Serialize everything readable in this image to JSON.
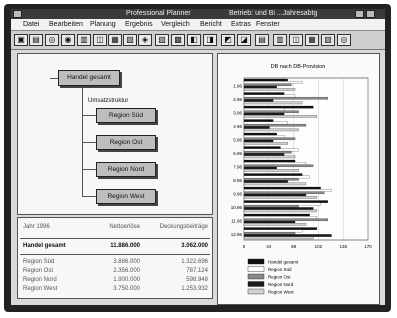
{
  "window": {
    "title": "Professional Planner",
    "subtitle": "Betrieb: und Bi ...Jahresabtg"
  },
  "menu": [
    "Datei",
    "Bearbeiten",
    "Planung",
    "Ergebnis",
    "Vergleich",
    "Bericht",
    "Extras",
    "Fenster"
  ],
  "tree": {
    "root": "Handel gesamt",
    "group_label": "Umsatzstruktur",
    "children": [
      "Region Süd",
      "Region Ost",
      "Region Nord",
      "Region West"
    ]
  },
  "table": {
    "headers": [
      "Jahr 1996",
      "Nettoerlöse",
      "Deckungsbeiträge"
    ],
    "total": {
      "name": "Handel gesamt",
      "net": "11.886.000",
      "db": "3.062.000"
    },
    "rows": [
      {
        "name": "Region Süd",
        "net": "3.886.000",
        "db": "1.322.696"
      },
      {
        "name": "Region Ost",
        "net": "2.356.000",
        "db": "787.124"
      },
      {
        "name": "Region Nord",
        "net": "1.900.000",
        "db": "598.948"
      },
      {
        "name": "Region West",
        "net": "3.750.000",
        "db": "1.253.932"
      }
    ]
  },
  "chart_data": {
    "type": "bar",
    "title": "DB nach DB-Provision",
    "categories": [
      "1.96",
      "2.96",
      "3.96",
      "4.96",
      "5.96",
      "6.96",
      "7.96",
      "8.96",
      "9.96",
      "10.96",
      "11.96",
      "12.96"
    ],
    "xlim": [
      0,
      170
    ],
    "xticks": [
      "0",
      "34",
      "68",
      "102",
      "136",
      "170"
    ],
    "series": [
      {
        "name": "Handel gesamt",
        "color": "#111111",
        "values": [
          60,
          55,
          95,
          40,
          45,
          50,
          70,
          80,
          105,
          115,
          90,
          100
        ]
      },
      {
        "name": "Region Süd",
        "color": "#ffffff",
        "values": [
          80,
          70,
          55,
          60,
          55,
          75,
          85,
          90,
          120,
          105,
          100,
          80
        ]
      },
      {
        "name": "Region Ost",
        "color": "#8a8a8a",
        "values": [
          65,
          115,
          75,
          85,
          70,
          65,
          95,
          75,
          110,
          75,
          115,
          70
        ]
      },
      {
        "name": "Region Nord",
        "color": "#1a1a1a",
        "values": [
          45,
          40,
          55,
          35,
          40,
          55,
          45,
          60,
          85,
          95,
          70,
          120
        ]
      },
      {
        "name": "Region West",
        "color": "#d0d0d0",
        "values": [
          70,
          80,
          100,
          75,
          60,
          70,
          75,
          85,
          100,
          100,
          85,
          95
        ]
      }
    ]
  }
}
